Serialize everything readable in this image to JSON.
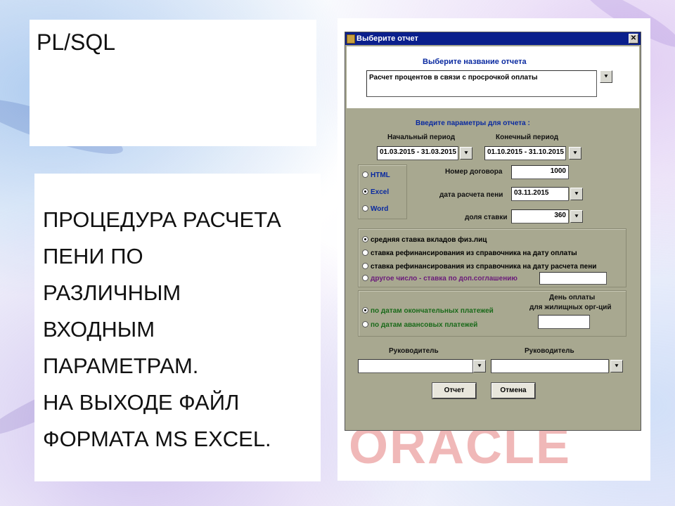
{
  "slide": {
    "title": "PL/SQL",
    "description_lines": [
      "ПРОЦЕДУРА РАСЧЕТА",
      "ПЕНИ ПО",
      "РАЗЛИЧНЫМ",
      "ВХОДНЫМ",
      "ПАРАМЕТРАМ.",
      "НА ВЫХОДЕ ФАЙЛ",
      "ФОРМАТА MS EXCEL."
    ]
  },
  "dialog": {
    "title": "Выберите отчет",
    "close_glyph": "✕",
    "report_heading": "Выберите название отчета",
    "report_name": "Расчет процентов в связи с просрочкой оплаты",
    "params_heading": "Введите параметры для отчета :",
    "start_period_label": "Начальный период",
    "start_period_value": "01.03.2015 - 31.03.2015",
    "end_period_label": "Конечный период",
    "end_period_value": "01.10.2015 - 31.10.2015",
    "format_options": [
      "HTML",
      "Excel",
      "Word"
    ],
    "format_selected": "Excel",
    "contract_label": "Номер договора",
    "contract_value": "1000",
    "calc_date_label": "дата расчета пени",
    "calc_date_value": "03.11.2015",
    "rate_share_label": "доля ставки",
    "rate_share_value": "360",
    "rate_options": [
      "средняя ставка вкладов физ.лиц",
      "ставка рефинансирования из справочника на дату оплаты",
      "ставка рефинансирования из справочника на дату расчета пени",
      "другое число - ставка по доп.соглашению"
    ],
    "rate_selected": "средняя ставка вкладов физ.лиц",
    "payment_options": [
      "по датам окончательных платежей",
      "по датам авансовых платежей"
    ],
    "payment_selected": "по датам окончательных платежей",
    "pay_day_label_1": "День оплаты",
    "pay_day_label_2": "для жилищных орг-ций",
    "manager_label_1": "Руководитель",
    "manager_label_2": "Руководитель",
    "report_button": "Отчет",
    "cancel_button": "Отмена",
    "dropdown_glyph": "⯆"
  },
  "watermark": "ORACLE",
  "colors": {
    "dialog_bg": "#a8a890",
    "titlebar": "#0a1f8c",
    "heading_blue": "#0a2aa0",
    "option_green": "#1a6a1a",
    "option_purple": "#6a1a7a",
    "watermark": "#f0b8b8"
  }
}
